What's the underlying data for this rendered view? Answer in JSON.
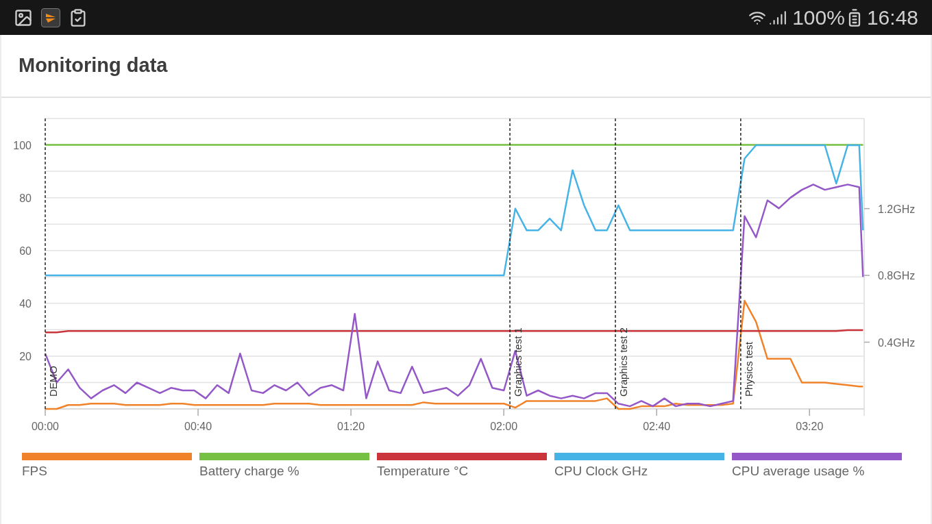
{
  "status_bar": {
    "battery": "100%",
    "time": "16:48"
  },
  "card": {
    "title": "Monitoring data",
    "chart_data": {
      "type": "line",
      "x": [
        0,
        3,
        6,
        9,
        12,
        15,
        18,
        21,
        24,
        27,
        30,
        33,
        36,
        39,
        42,
        45,
        48,
        51,
        54,
        57,
        60,
        63,
        66,
        69,
        72,
        75,
        78,
        81,
        84,
        87,
        90,
        93,
        96,
        99,
        102,
        105,
        108,
        111,
        114,
        117,
        120,
        123,
        126,
        129,
        132,
        135,
        138,
        141,
        144,
        147,
        150,
        153,
        156,
        159,
        162,
        165,
        168,
        171,
        174,
        177,
        180,
        183,
        186,
        189,
        192,
        195,
        198,
        201,
        204,
        207,
        210,
        213,
        214
      ],
      "xlim": [
        0,
        214.3
      ],
      "ylim": [
        0,
        110
      ],
      "y2lim": [
        0,
        1.74
      ],
      "xticks": [
        {
          "value": 0,
          "label": "00:00"
        },
        {
          "value": 40,
          "label": "00:40"
        },
        {
          "value": 80,
          "label": "01:20"
        },
        {
          "value": 120,
          "label": "02:00"
        },
        {
          "value": 160,
          "label": "02:40"
        },
        {
          "value": 200,
          "label": "03:20"
        }
      ],
      "yticks": [
        {
          "value": 20,
          "label": "20"
        },
        {
          "value": 40,
          "label": "40"
        },
        {
          "value": 60,
          "label": "60"
        },
        {
          "value": 80,
          "label": "80"
        },
        {
          "value": 100,
          "label": "100"
        }
      ],
      "y2ticks": [
        {
          "value": 0.4,
          "label": "0.4GHz"
        },
        {
          "value": 0.8,
          "label": "0.8GHz"
        },
        {
          "value": 1.2,
          "label": "1.2GHz"
        }
      ],
      "grid": true,
      "ref_lines": [
        {
          "axis": "x",
          "value": 0,
          "label": "DEMO"
        },
        {
          "axis": "x",
          "value": 121.6,
          "label": "Graphics test 1"
        },
        {
          "axis": "x",
          "value": 149.2,
          "label": "Graphics test 2"
        },
        {
          "axis": "x",
          "value": 182,
          "label": "Physics test"
        }
      ],
      "series": [
        {
          "name": "FPS",
          "color": "#f0822a",
          "values": [
            0,
            0,
            1.5,
            1.5,
            2,
            2,
            2,
            1.5,
            1.5,
            1.5,
            1.5,
            2,
            2,
            1.5,
            1.5,
            1.5,
            1.5,
            1.5,
            1.5,
            1.5,
            2,
            2,
            2,
            2,
            1.5,
            1.5,
            1.5,
            1.5,
            1.5,
            1.5,
            1.5,
            1.5,
            1.5,
            2.5,
            2,
            2,
            2,
            2,
            2,
            2,
            2,
            0.5,
            3,
            3,
            3,
            3,
            3,
            3,
            3,
            4,
            0,
            0,
            1,
            1,
            1,
            2,
            1.5,
            1.5,
            1.5,
            1.5,
            2,
            41,
            33,
            19,
            19,
            19,
            10,
            10,
            10,
            9.5,
            9,
            8.5,
            8.5
          ]
        },
        {
          "name": "Battery charge %",
          "color": "#76c043",
          "values": [
            100,
            100,
            100,
            100,
            100,
            100,
            100,
            100,
            100,
            100,
            100,
            100,
            100,
            100,
            100,
            100,
            100,
            100,
            100,
            100,
            100,
            100,
            100,
            100,
            100,
            100,
            100,
            100,
            100,
            100,
            100,
            100,
            100,
            100,
            100,
            100,
            100,
            100,
            100,
            100,
            100,
            100,
            100,
            100,
            100,
            100,
            100,
            100,
            100,
            100,
            100,
            100,
            100,
            100,
            100,
            100,
            100,
            100,
            100,
            100,
            100,
            100,
            100,
            100,
            100,
            100,
            100,
            100,
            100,
            100,
            100,
            100,
            100
          ]
        },
        {
          "name": "Temperature °C",
          "color": "#c9353b",
          "values": [
            29,
            29,
            29.5,
            29.5,
            29.5,
            29.5,
            29.5,
            29.5,
            29.5,
            29.5,
            29.5,
            29.5,
            29.5,
            29.5,
            29.5,
            29.5,
            29.5,
            29.5,
            29.5,
            29.5,
            29.5,
            29.5,
            29.5,
            29.5,
            29.5,
            29.5,
            29.5,
            29.5,
            29.5,
            29.5,
            29.5,
            29.5,
            29.5,
            29.5,
            29.5,
            29.5,
            29.5,
            29.5,
            29.5,
            29.5,
            29.5,
            29.5,
            29.5,
            29.5,
            29.5,
            29.5,
            29.5,
            29.5,
            29.5,
            29.5,
            29.5,
            29.5,
            29.5,
            29.5,
            29.5,
            29.5,
            29.5,
            29.5,
            29.5,
            29.5,
            29.5,
            29.5,
            29.5,
            29.5,
            29.5,
            29.5,
            29.5,
            29.5,
            29.5,
            29.5,
            29.8,
            29.8,
            29.8
          ]
        },
        {
          "name": "CPU Clock GHz",
          "color": "#45b3e6",
          "axis": "y2",
          "values": [
            0.8,
            0.8,
            0.8,
            0.8,
            0.8,
            0.8,
            0.8,
            0.8,
            0.8,
            0.8,
            0.8,
            0.8,
            0.8,
            0.8,
            0.8,
            0.8,
            0.8,
            0.8,
            0.8,
            0.8,
            0.8,
            0.8,
            0.8,
            0.8,
            0.8,
            0.8,
            0.8,
            0.8,
            0.8,
            0.8,
            0.8,
            0.8,
            0.8,
            0.8,
            0.8,
            0.8,
            0.8,
            0.8,
            0.8,
            0.8,
            0.8,
            1.2,
            1.07,
            1.07,
            1.14,
            1.07,
            1.43,
            1.22,
            1.07,
            1.07,
            1.22,
            1.07,
            1.07,
            1.07,
            1.07,
            1.07,
            1.07,
            1.07,
            1.07,
            1.07,
            1.07,
            1.5,
            1.58,
            1.58,
            1.58,
            1.58,
            1.58,
            1.58,
            1.58,
            1.35,
            1.58,
            1.58,
            1.07
          ]
        },
        {
          "name": "CPU average usage %",
          "color": "#9457c7",
          "values": [
            21,
            10,
            15,
            8,
            4,
            7,
            9,
            6,
            10,
            8,
            6,
            8,
            7,
            7,
            4,
            9,
            6,
            21,
            7,
            6,
            9,
            7,
            10,
            5,
            8,
            9,
            7,
            36,
            4,
            18,
            7,
            6,
            16,
            6,
            7,
            8,
            5,
            9,
            19,
            8,
            7,
            22,
            5,
            7,
            5,
            4,
            5,
            4,
            6,
            6,
            2,
            1,
            3,
            1,
            4,
            1,
            2,
            2,
            1,
            2,
            3,
            73,
            65,
            79,
            76,
            80,
            83,
            85,
            83,
            84,
            85,
            84,
            50
          ]
        }
      ]
    }
  }
}
